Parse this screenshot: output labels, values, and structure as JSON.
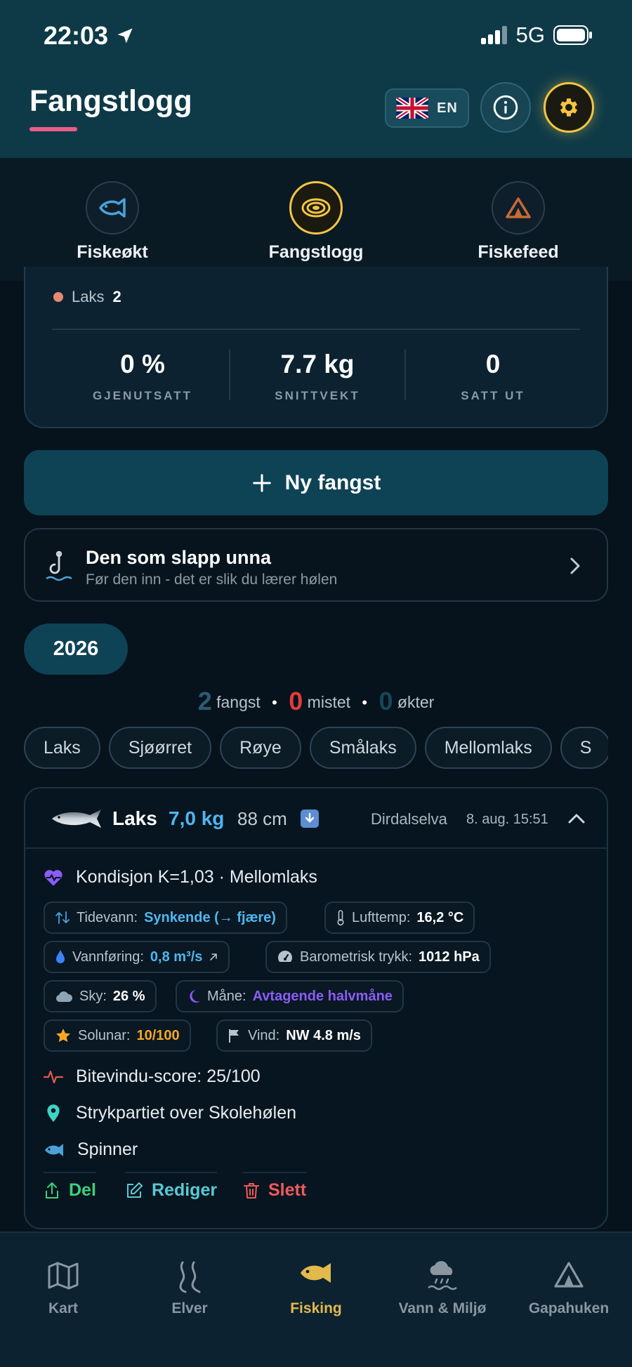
{
  "status": {
    "time": "22:03",
    "network": "5G"
  },
  "header": {
    "title": "Fangstlogg",
    "lang_label": "EN"
  },
  "tabs": [
    {
      "label": "Fiskeøkt",
      "active": false
    },
    {
      "label": "Fangstlogg",
      "active": true
    },
    {
      "label": "Fiskefeed",
      "active": false
    }
  ],
  "stats": {
    "species_label": "Laks",
    "species_count": "2",
    "items": [
      {
        "value": "0 %",
        "label": "GJENUTSATT"
      },
      {
        "value": "7.7 kg",
        "label": "SNITTVEKT"
      },
      {
        "value": "0",
        "label": "SATT UT"
      }
    ]
  },
  "new_catch_label": "Ny fangst",
  "escape": {
    "title": "Den som slapp unna",
    "subtitle": "Før den inn - det er slik du lærer hølen"
  },
  "year": "2026",
  "summary": {
    "caught_count": "2",
    "caught_label": "fangst",
    "lost_count": "0",
    "lost_label": "mistet",
    "sessions_count": "0",
    "sessions_label": "økter"
  },
  "filters": [
    "Laks",
    "Sjøørret",
    "Røye",
    "Smålaks",
    "Mellomlaks",
    "S"
  ],
  "catch": {
    "species": "Laks",
    "weight": "7,0 kg",
    "length": "88 cm",
    "river": "Dirdalselva",
    "date": "8. aug. 15:51",
    "condition": "Kondisjon K=1,03 · Mellomlaks",
    "badges": {
      "tide_label": "Tidevann:",
      "tide_value": "Synkende (→ fjære)",
      "airtemp_label": "Lufttemp:",
      "airtemp_value": "16,2 °C",
      "flow_label": "Vannføring:",
      "flow_value": "0,8 m³/s",
      "pressure_label": "Barometrisk trykk:",
      "pressure_value": "1012 hPa",
      "sky_label": "Sky:",
      "sky_value": "26 %",
      "moon_label": "Måne:",
      "moon_value": "Avtagende halvmåne",
      "solunar_label": "Solunar:",
      "solunar_value": "10/100",
      "wind_label": "Vind:",
      "wind_value": "NW 4.8 m/s"
    },
    "bite_score": "Bitevindu-score: 25/100",
    "location": "Strykpartiet over Skolehølen",
    "lure": "Spinner",
    "actions": {
      "share": "Del",
      "edit": "Rediger",
      "delete": "Slett"
    }
  },
  "bottom_nav": [
    {
      "label": "Kart",
      "active": false
    },
    {
      "label": "Elver",
      "active": false
    },
    {
      "label": "Fisking",
      "active": true
    },
    {
      "label": "Vann & Miljø",
      "active": false
    },
    {
      "label": "Gapahuken",
      "active": false
    }
  ],
  "colors": {
    "header_bg": "#0e3a48",
    "accent_yellow": "#f4c542",
    "weight_blue": "#4fb6ef",
    "share_green": "#3fcf7a",
    "edit_teal": "#58c9d3",
    "delete_red": "#ec5b5b",
    "moon_purple": "#8b5cf6",
    "solunar_orange": "#f6a623"
  },
  "icons": {
    "status": [
      "location-arrow-icon",
      "signal-bars-icon",
      "battery-icon"
    ],
    "header": [
      "uk-flag-icon",
      "info-icon",
      "gear-icon"
    ],
    "tabs": [
      "fish-icon",
      "target-icon",
      "tent-icon"
    ],
    "bottom_nav": [
      "map-icon",
      "river-icon",
      "fish-icon",
      "weather-icon",
      "shelter-icon"
    ]
  }
}
